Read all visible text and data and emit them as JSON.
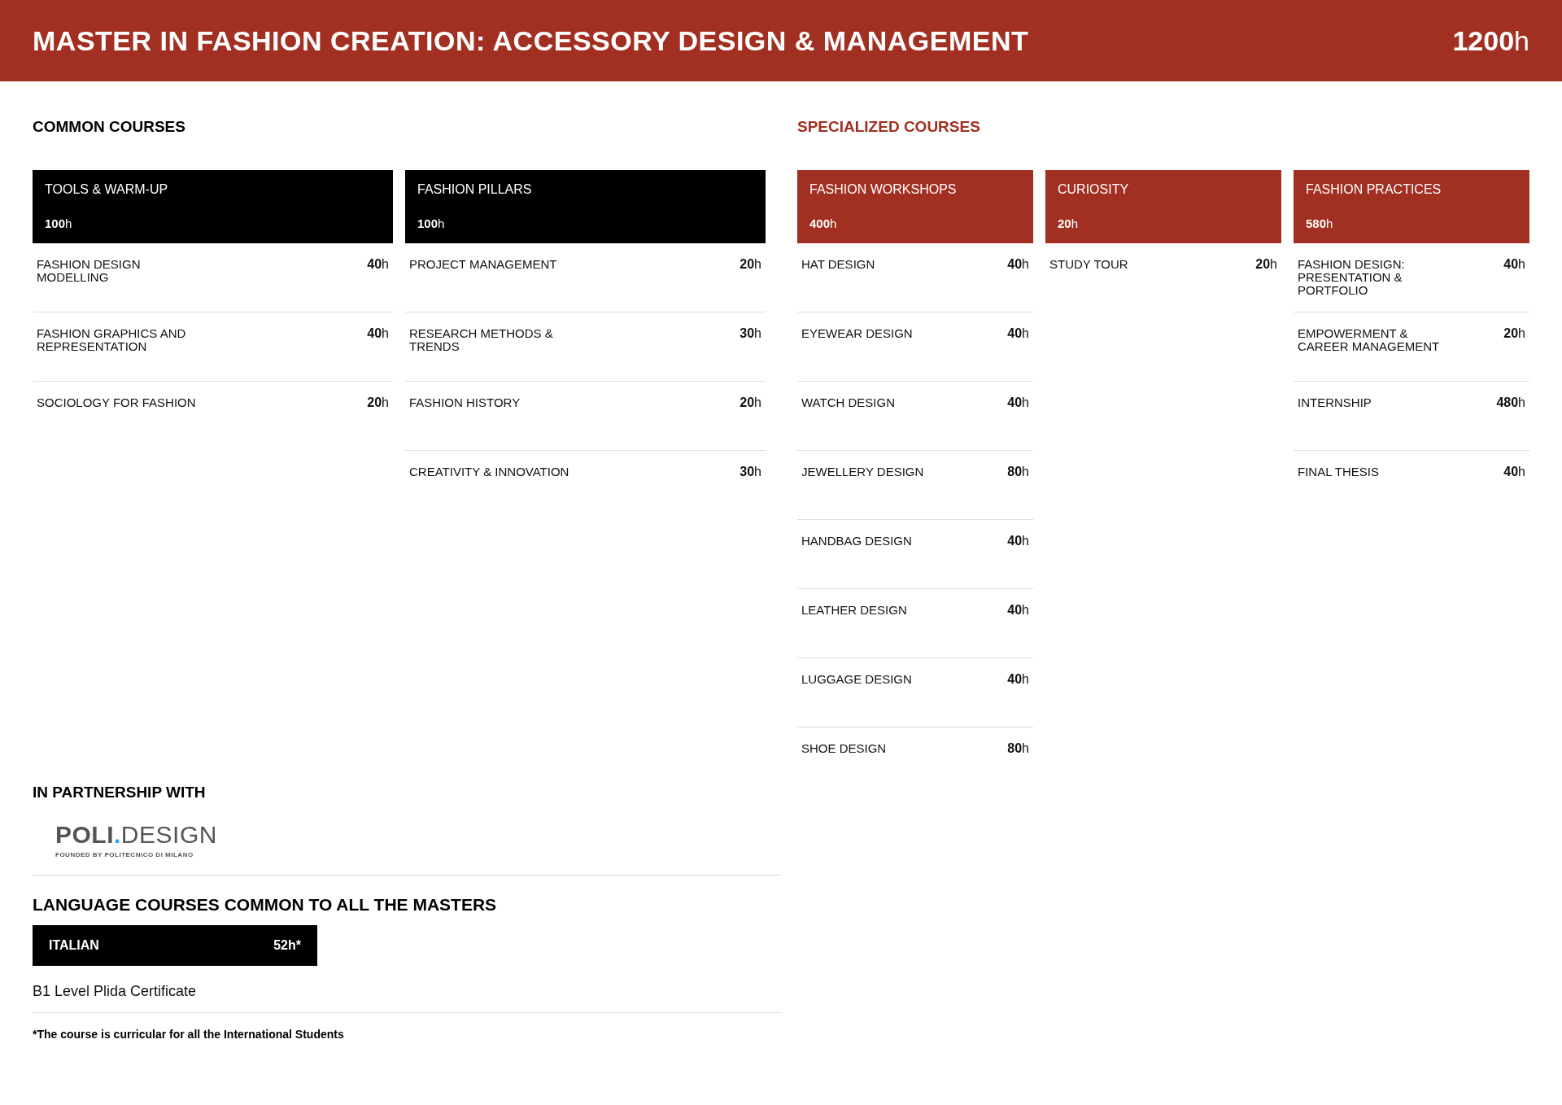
{
  "header": {
    "title": "MASTER IN FASHION CREATION: ACCESSORY DESIGN & MANAGEMENT",
    "total": "**1200**h"
  },
  "sections": [
    {
      "title": "COMMON COURSES",
      "color": "#000000",
      "groups": [
        {
          "name": "TOOLS & WARM-UP",
          "hours": "**100**h",
          "courses": [
            {
              "name": "FASHION DESIGN MODELLING",
              "hours": "**40**h"
            },
            {
              "name": "FASHION GRAPHICS AND REPRESENTATION",
              "hours": "**40**h"
            },
            {
              "name": "SOCIOLOGY FOR FASHION",
              "hours": "**20**h"
            }
          ]
        },
        {
          "name": "FASHION PILLARS",
          "hours": "**100**h",
          "courses": [
            {
              "name": "PROJECT MANAGEMENT",
              "hours": "**20**h"
            },
            {
              "name": "RESEARCH METHODS & TRENDS",
              "hours": "**30**h"
            },
            {
              "name": "FASHION HISTORY",
              "hours": "**20**h"
            },
            {
              "name": "CREATIVITY & INNOVATION",
              "hours": "**30**h"
            }
          ]
        }
      ]
    },
    {
      "title": "SPECIALIZED COURSES",
      "color": "#a23022",
      "groups": [
        {
          "name": "FASHION WORKSHOPS",
          "hours": "**400**h",
          "courses": [
            {
              "name": "HAT DESIGN",
              "hours": "**40**h"
            },
            {
              "name": "EYEWEAR DESIGN",
              "hours": "**40**h"
            },
            {
              "name": "WATCH DESIGN",
              "hours": "**40**h"
            },
            {
              "name": "JEWELLERY DESIGN",
              "hours": "**80**h"
            },
            {
              "name": "HANDBAG DESIGN",
              "hours": "**40**h"
            },
            {
              "name": "LEATHER DESIGN",
              "hours": "**40**h"
            },
            {
              "name": "LUGGAGE DESIGN",
              "hours": "**40**h"
            },
            {
              "name": "SHOE DESIGN",
              "hours": "**80**h"
            }
          ]
        },
        {
          "name": "CURIOSITY",
          "hours": "**20**h",
          "courses": [
            {
              "name": "STUDY TOUR",
              "hours": "**20**h"
            }
          ]
        },
        {
          "name": "FASHION PRACTICES",
          "hours": "**580**h",
          "courses": [
            {
              "name": "FASHION DESIGN: PRESENTATION & PORTFOLIO",
              "hours": "**40**h"
            },
            {
              "name": "EMPOWERMENT & CAREER MANAGEMENT",
              "hours": "**20**h"
            },
            {
              "name": "INTERNSHIP",
              "hours": "**480**h"
            },
            {
              "name": "FINAL THESIS",
              "hours": "**40**h"
            }
          ]
        }
      ]
    }
  ],
  "partnership": {
    "title": "IN PARTNERSHIP WITH",
    "logo": {
      "bold": "POLI",
      "dot": ".",
      "light": "DESIGN",
      "tagline": "FOUNDED BY POLITECNICO DI MILANO"
    }
  },
  "languages": {
    "title": "LANGUAGE COURSES COMMON TO ALL THE MASTERS",
    "courses": [
      {
        "name": "ITALIAN",
        "hours": "52h*"
      }
    ],
    "note": "B1 Level Plida Certificate",
    "footnote": "*The course is curricular for all the International Students"
  }
}
